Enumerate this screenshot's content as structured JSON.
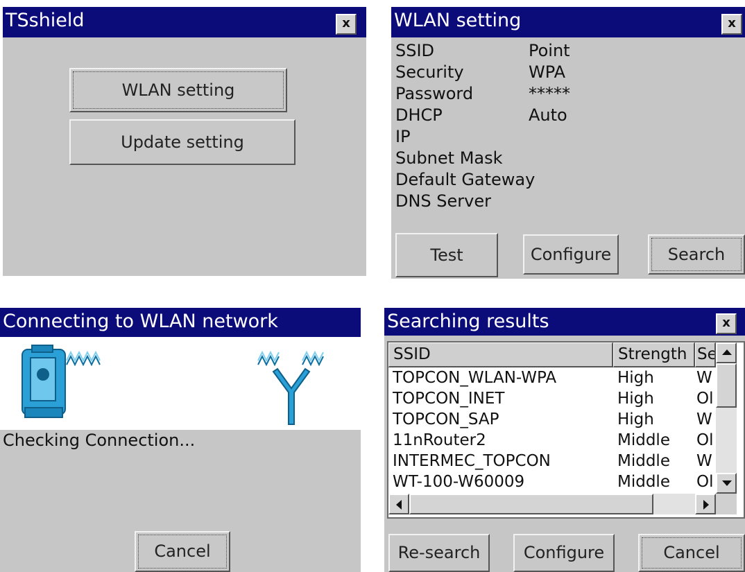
{
  "tsshield": {
    "title": "TSshield",
    "close_label": "x",
    "wlan_button": "WLAN setting",
    "update_button": "Update setting"
  },
  "wlan": {
    "title": "WLAN setting",
    "close_label": "x",
    "fields": [
      {
        "label": "SSID",
        "value": "Point"
      },
      {
        "label": "Security",
        "value": "WPA"
      },
      {
        "label": "Password",
        "value": "*****"
      },
      {
        "label": "DHCP",
        "value": "Auto"
      },
      {
        "label": "IP",
        "value": ""
      },
      {
        "label": "Subnet Mask",
        "value": ""
      },
      {
        "label": "Default Gateway",
        "value": ""
      },
      {
        "label": "DNS Server",
        "value": ""
      }
    ],
    "test_button": "Test",
    "configure_button": "Configure",
    "search_button": "Search"
  },
  "connecting": {
    "title": "Connecting to WLAN network",
    "status": "Checking Connection...",
    "cancel_button": "Cancel"
  },
  "search": {
    "title": "Searching results",
    "close_label": "x",
    "columns": [
      "SSID",
      "Strength",
      "Se"
    ],
    "rows": [
      {
        "ssid": "TOPCON_WLAN-WPA",
        "strength": "High",
        "security": "W"
      },
      {
        "ssid": "TOPCON_INET",
        "strength": "High",
        "security": "Ol"
      },
      {
        "ssid": "TOPCON_SAP",
        "strength": "High",
        "security": "W"
      },
      {
        "ssid": "11nRouter2",
        "strength": "Middle",
        "security": "Ol"
      },
      {
        "ssid": "INTERMEC_TOPCON",
        "strength": "Middle",
        "security": "W"
      },
      {
        "ssid": "WT-100-W60009",
        "strength": "Middle",
        "security": "Ol"
      }
    ],
    "research_button": "Re-search",
    "configure_button": "Configure",
    "cancel_button": "Cancel"
  },
  "colors": {
    "titlebar": "#0b0b7a",
    "window_bg": "#c6c6c6",
    "icon_blue": "#2aa0d6"
  }
}
